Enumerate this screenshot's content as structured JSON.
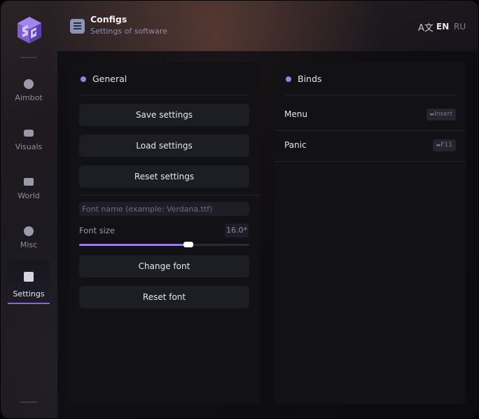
{
  "header": {
    "title": "Configs",
    "subtitle": "Settings of software",
    "languages": [
      "EN",
      "RU"
    ],
    "active_language": "EN",
    "icon": "list-icon",
    "translate_icon": "translate-icon"
  },
  "sidebar": {
    "items": [
      {
        "label": "Aimbot",
        "icon": "alien-icon"
      },
      {
        "label": "Visuals",
        "icon": "vr-goggles-icon"
      },
      {
        "label": "World",
        "icon": "briefcase-icon"
      },
      {
        "label": "Misc",
        "icon": "more-icon"
      },
      {
        "label": "Settings",
        "icon": "list-icon",
        "active": true
      }
    ]
  },
  "general": {
    "title": "General",
    "buttons": {
      "save": "Save settings",
      "load": "Load settings",
      "reset": "Reset settings",
      "change_font": "Change font",
      "reset_font": "Reset font"
    },
    "font_name_placeholder": "Font name (example: Verdana.ttf)",
    "font_size_label": "Font size",
    "font_size_value": "16.0*",
    "font_size_fraction": 0.64
  },
  "binds": {
    "title": "Binds",
    "rows": [
      {
        "name": "Menu",
        "key": "Insert"
      },
      {
        "name": "Panic",
        "key": "F11"
      }
    ]
  },
  "colors": {
    "accent": "#9c7be4"
  }
}
